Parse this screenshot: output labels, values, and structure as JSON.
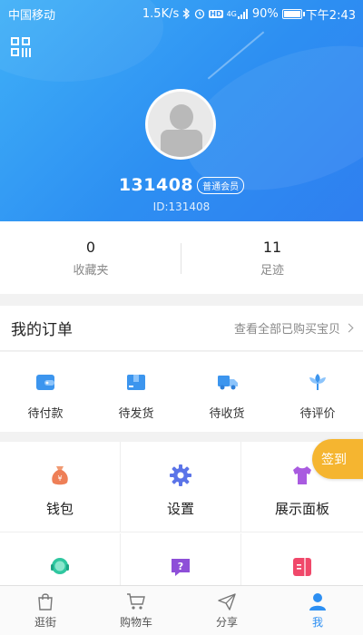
{
  "status_bar": {
    "carrier": "中国移动",
    "speed": "1.5K/s",
    "hd": "HD",
    "network": "4G",
    "battery": "90%",
    "battery_level": 0.9,
    "time": "下午2:43"
  },
  "profile": {
    "username": "131408",
    "member_badge": "普通会员",
    "user_id": "ID:131408"
  },
  "stats": [
    {
      "value": "0",
      "label": "收藏夹"
    },
    {
      "value": "11",
      "label": "足迹"
    }
  ],
  "orders": {
    "title": "我的订单",
    "view_all": "查看全部已购买宝贝",
    "items": [
      {
        "label": "待付款",
        "icon": "wallet-icon"
      },
      {
        "label": "待发货",
        "icon": "package-icon"
      },
      {
        "label": "待收货",
        "icon": "truck-icon"
      },
      {
        "label": "待评价",
        "icon": "flower-icon"
      }
    ]
  },
  "services": [
    {
      "label": "钱包",
      "icon": "money-bag-icon"
    },
    {
      "label": "设置",
      "icon": "gear-icon"
    },
    {
      "label": "展示面板",
      "icon": "tshirt-icon"
    }
  ],
  "signin_label": "签到",
  "tabs": [
    {
      "label": "逛街",
      "icon": "shopping-bag-icon"
    },
    {
      "label": "购物车",
      "icon": "cart-icon"
    },
    {
      "label": "分享",
      "icon": "paper-plane-icon"
    },
    {
      "label": "我",
      "icon": "person-icon"
    }
  ],
  "colors": {
    "brand": "#2d8ff2",
    "signin": "#f5b530"
  }
}
